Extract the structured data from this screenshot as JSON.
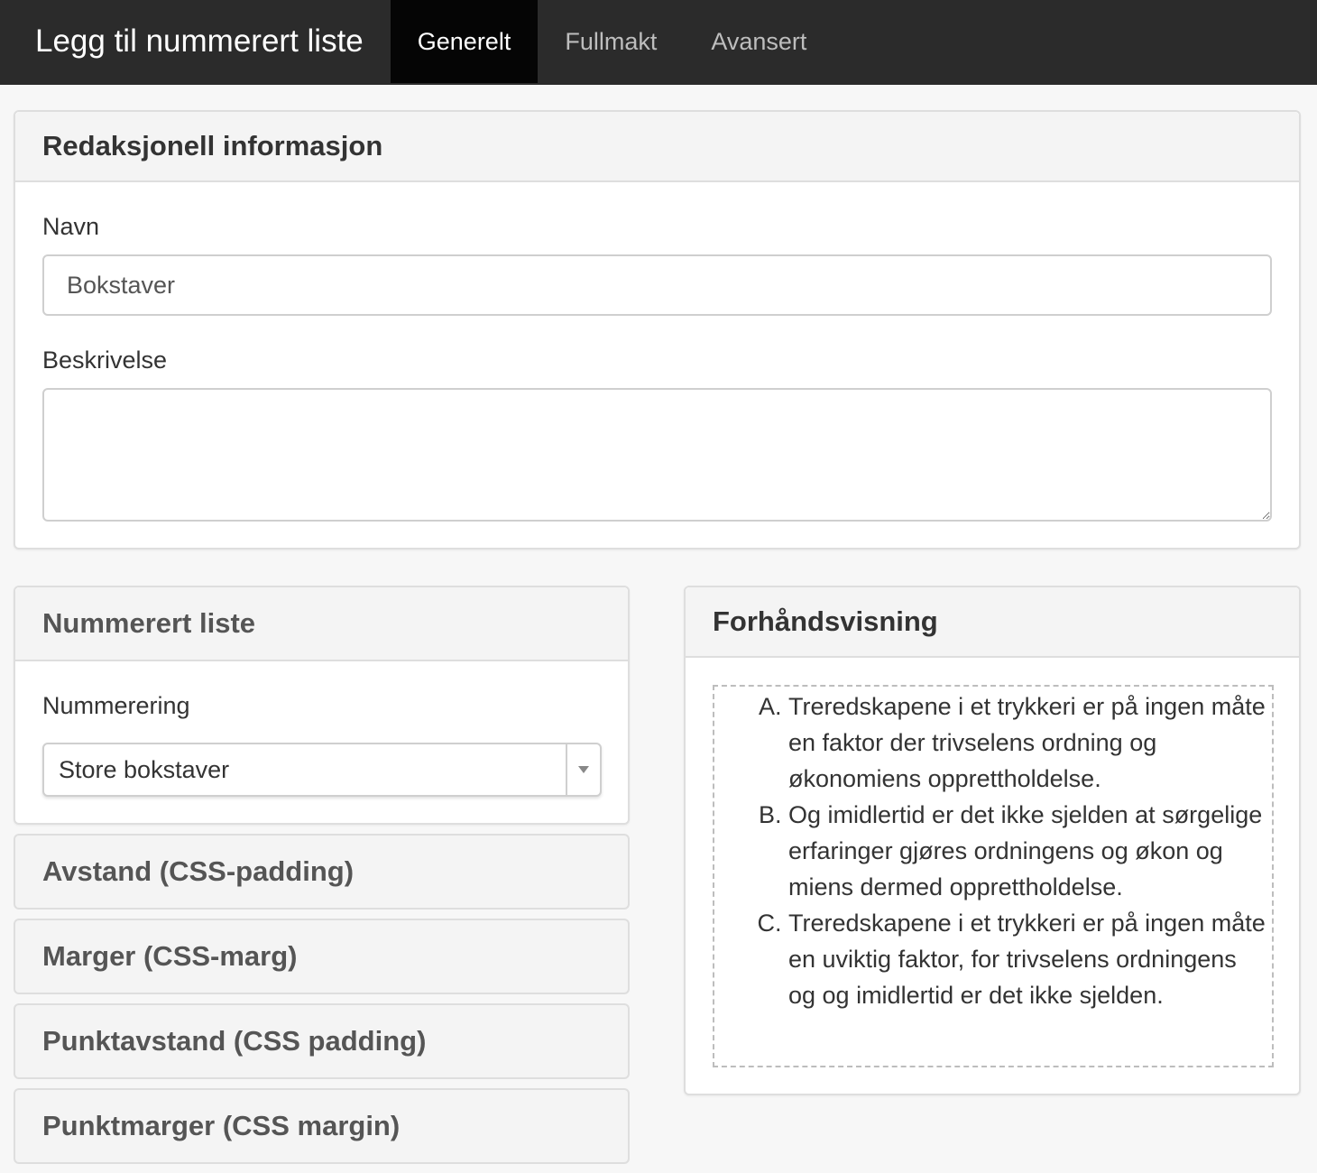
{
  "app": {
    "title": "Legg til nummerert liste"
  },
  "tabs": [
    {
      "label": "Generelt",
      "active": true
    },
    {
      "label": "Fullmakt",
      "active": false
    },
    {
      "label": "Avansert",
      "active": false
    }
  ],
  "editorial": {
    "heading": "Redaksjonell informasjon",
    "name_label": "Navn",
    "name_value": "Bokstaver",
    "description_label": "Beskrivelse",
    "description_value": ""
  },
  "numbered_list": {
    "heading": "Nummerert liste",
    "numbering_label": "Nummerering",
    "numbering_value": "Store bokstaver"
  },
  "collapsed_sections": [
    {
      "label": "Avstand (CSS-padding)"
    },
    {
      "label": "Marger (CSS-marg)"
    },
    {
      "label": "Punktavstand (CSS padding)"
    },
    {
      "label": "Punktmarger (CSS margin)"
    }
  ],
  "preview": {
    "heading": "Forhåndsvisning",
    "items": [
      "Treredskapene i et trykkeri er på ingen måte en faktor der trivselens ordning og økonomiens opprettholdelse.",
      "Og imidlertid er det ikke sjelden at sørgelige erfaringer gjøres ordningens og økon og miens dermed opprettholdelse.",
      "Treredskapene i et trykkeri er på ingen måte en uviktig faktor, for trivselens ordningens og og imidlertid er det ikke sjelden."
    ]
  },
  "colors": {
    "topbar": "#2b2b2b",
    "active_tab": "#050505",
    "panel_header": "#f4f4f4"
  }
}
